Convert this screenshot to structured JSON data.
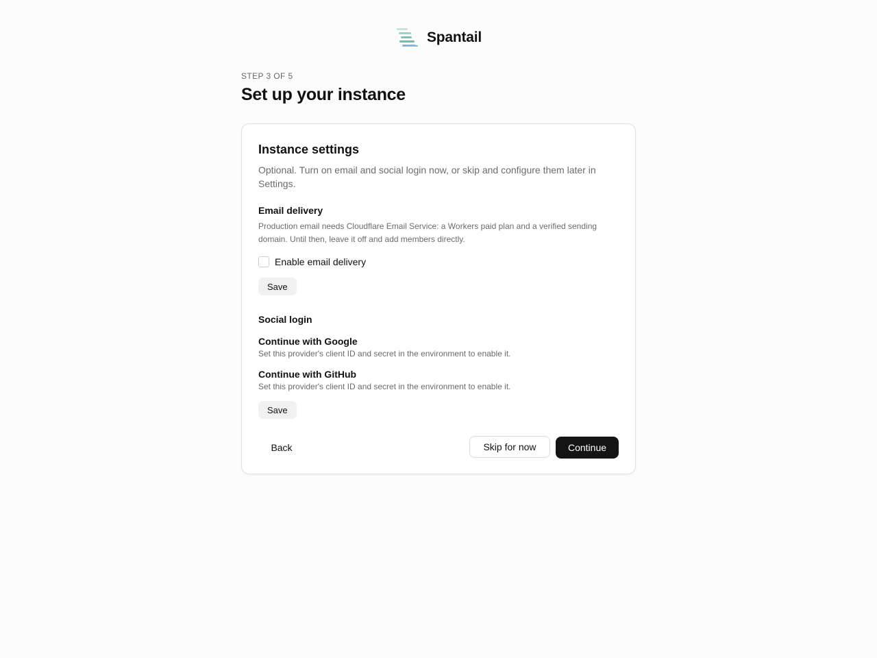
{
  "brand": {
    "name": "Spantail",
    "logo_icon": "spantail-stripes-logo",
    "logo_colors": [
      "#a8e0dc",
      "#7ccfc2",
      "#5fc4b0",
      "#7fb6e8",
      "#59c9d8"
    ]
  },
  "header": {
    "step": "STEP 3 OF 5",
    "title": "Set up your instance"
  },
  "card": {
    "title": "Instance settings",
    "description": "Optional. Turn on email and social login now, or skip and configure them later in Settings.",
    "email": {
      "title": "Email delivery",
      "description": "Production email needs Cloudflare Email Service: a Workers paid plan and a verified sending domain. Until then, leave it off and add members directly.",
      "checkbox_label": "Enable email delivery",
      "checked": false,
      "save_label": "Save"
    },
    "social": {
      "title": "Social login",
      "providers": [
        {
          "name": "Continue with Google",
          "description": "Set this provider's client ID and secret in the environment to enable it."
        },
        {
          "name": "Continue with GitHub",
          "description": "Set this provider's client ID and secret in the environment to enable it."
        }
      ],
      "save_label": "Save"
    }
  },
  "footer": {
    "back_label": "Back",
    "skip_label": "Skip for now",
    "continue_label": "Continue"
  },
  "colors": {
    "primary_button": "#141414",
    "page_background": "#fcfcfc",
    "muted_text": "#6b6b6b"
  }
}
